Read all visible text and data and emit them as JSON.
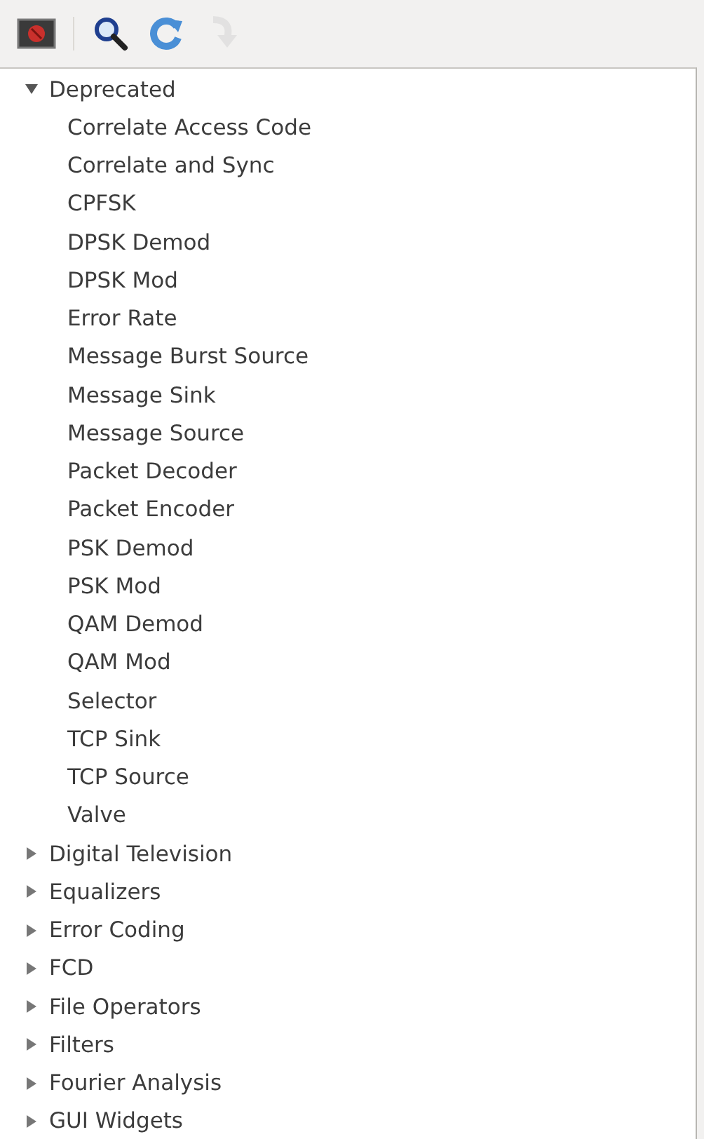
{
  "toolbar": [
    {
      "kind": "stop",
      "disabled": false
    },
    {
      "kind": "search",
      "disabled": false
    },
    {
      "kind": "refresh",
      "disabled": false
    },
    {
      "kind": "redo",
      "disabled": true
    }
  ],
  "tree": [
    {
      "label": "Deprecated",
      "expanded": true,
      "children": [
        {
          "label": "Correlate Access Code"
        },
        {
          "label": "Correlate and Sync"
        },
        {
          "label": "CPFSK"
        },
        {
          "label": "DPSK Demod"
        },
        {
          "label": "DPSK Mod"
        },
        {
          "label": "Error Rate"
        },
        {
          "label": "Message Burst Source"
        },
        {
          "label": "Message Sink"
        },
        {
          "label": "Message Source"
        },
        {
          "label": "Packet Decoder"
        },
        {
          "label": "Packet Encoder"
        },
        {
          "label": "PSK Demod"
        },
        {
          "label": "PSK Mod"
        },
        {
          "label": "QAM Demod"
        },
        {
          "label": "QAM Mod"
        },
        {
          "label": "Selector"
        },
        {
          "label": "TCP Sink"
        },
        {
          "label": "TCP Source"
        },
        {
          "label": "Valve"
        }
      ]
    },
    {
      "label": "Digital Television",
      "expanded": false
    },
    {
      "label": "Equalizers",
      "expanded": false
    },
    {
      "label": "Error Coding",
      "expanded": false
    },
    {
      "label": "FCD",
      "expanded": false
    },
    {
      "label": "File Operators",
      "expanded": false
    },
    {
      "label": "Filters",
      "expanded": false
    },
    {
      "label": "Fourier Analysis",
      "expanded": false
    },
    {
      "label": "GUI Widgets",
      "expanded": false
    }
  ]
}
